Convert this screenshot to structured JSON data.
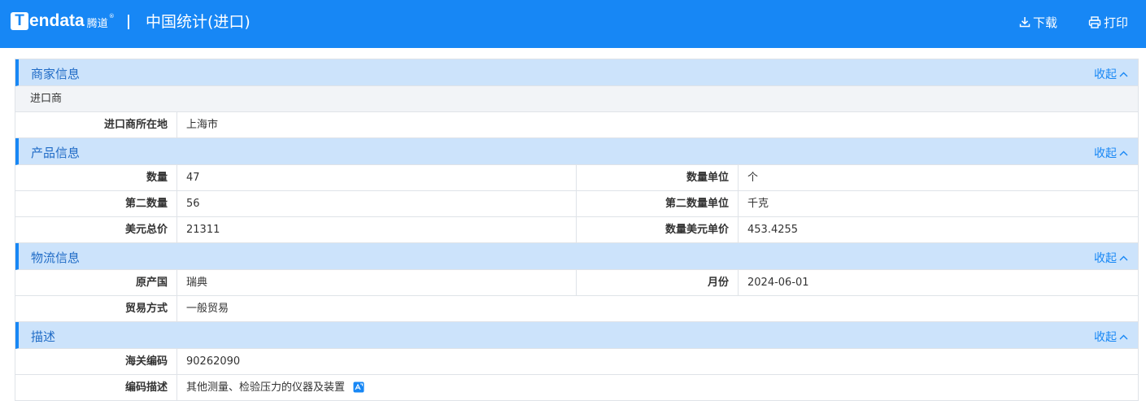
{
  "header": {
    "logo_letter": "T",
    "logo_word": "endata",
    "logo_cn": "腾道",
    "logo_reg": "®",
    "title": "中国统计(进口)",
    "download_label": "下载",
    "print_label": "打印",
    "download_icon": "download-icon",
    "print_icon": "printer-icon"
  },
  "colors": {
    "primary": "#1787f5",
    "section_bg": "#cce3fb",
    "subrow_bg": "#f2f4f7"
  },
  "toggle_label": "收起",
  "merchant": {
    "title": "商家信息",
    "subheader": "进口商",
    "location_label": "进口商所在地",
    "location_value": "上海市"
  },
  "product": {
    "title": "产品信息",
    "rows": [
      {
        "l1": "数量",
        "v1": "47",
        "l2": "数量单位",
        "v2": "个"
      },
      {
        "l1": "第二数量",
        "v1": "56",
        "l2": "第二数量单位",
        "v2": "千克"
      },
      {
        "l1": "美元总价",
        "v1": "21311",
        "l2": "数量美元单价",
        "v2": "453.4255"
      }
    ]
  },
  "logistics": {
    "title": "物流信息",
    "origin_label": "原产国",
    "origin_value": "瑞典",
    "month_label": "月份",
    "month_value": "2024-06-01",
    "trade_label": "贸易方式",
    "trade_value": "一般贸易"
  },
  "description": {
    "title": "描述",
    "hs_label": "海关编码",
    "hs_value": "90262090",
    "desc_label": "编码描述",
    "desc_value": "其他测量、检验压力的仪器及装置"
  }
}
